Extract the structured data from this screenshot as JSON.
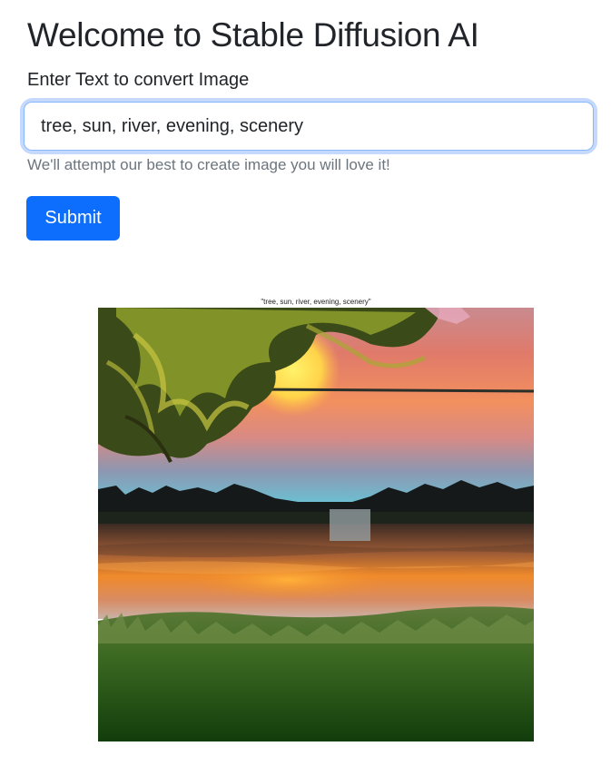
{
  "header": {
    "title": "Welcome to Stable Diffusion AI"
  },
  "form": {
    "label": "Enter Text to convert Image",
    "input_value": "tree, sun, river, evening, scenery",
    "help_text": "We'll attempt our best to create image you will love it!",
    "submit_label": "Submit"
  },
  "result": {
    "caption": "\"tree, sun, river, evening, scenery\""
  },
  "colors": {
    "accent": "#0d6efd",
    "focus_ring": "#c4d9fb",
    "muted_text": "#6c757d"
  }
}
